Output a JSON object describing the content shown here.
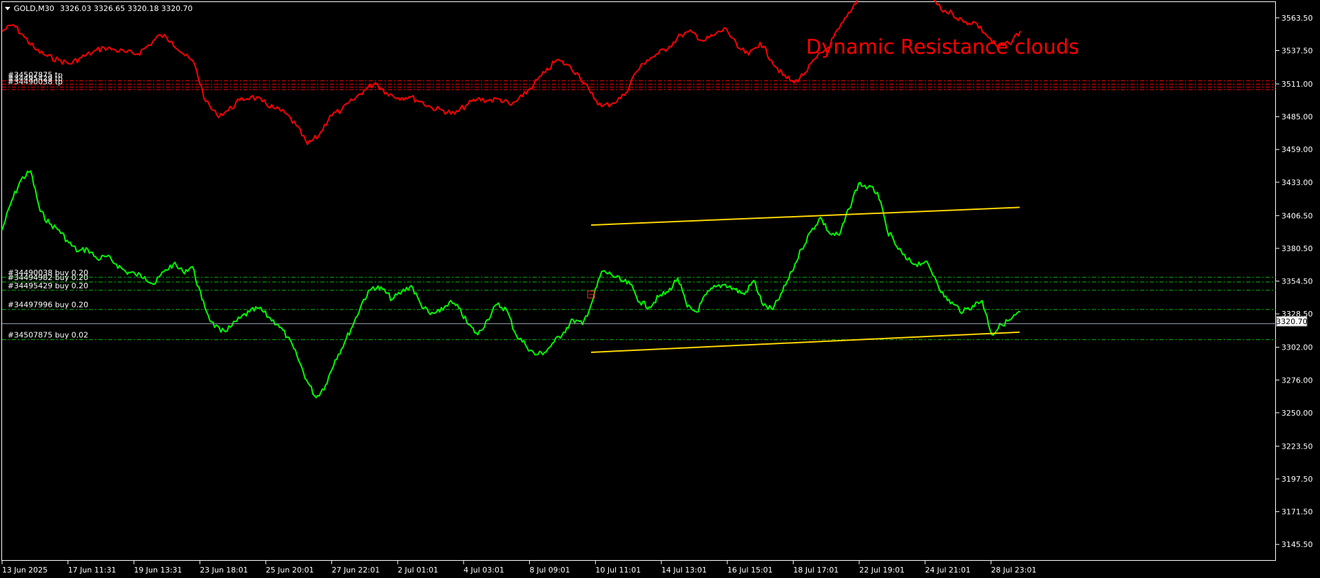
{
  "window": {
    "symbol_tf": "GOLD,M30",
    "ohlc": "3326.03 3326.65 3320.18 3320.70"
  },
  "annotation": {
    "text": "Dynamic Resistance clouds",
    "color": "#ff0000"
  },
  "current_price": {
    "label": "3320.70",
    "value": 3320.7
  },
  "orders": {
    "tp_labels": [
      "#34507875 tp",
      "#34495429 tp",
      "#34490038 tp"
    ],
    "buy": [
      {
        "label": "#34490038 buy 0.20",
        "price": 3357.5
      },
      {
        "label": "#34494982 buy 0.20",
        "price": 3353.8
      },
      {
        "label": "#34495429 buy 0.20",
        "price": 3347.2
      },
      {
        "label": "#34497996 buy 0.20",
        "price": 3332.0
      },
      {
        "label": "#34507875 buy 0.02",
        "price": 3308.0
      }
    ],
    "tp_prices": [
      3513.5,
      3510.8,
      3508.5,
      3506.5
    ]
  },
  "colors": {
    "price_line": "#00ff00",
    "resistance_line": "#ff0000",
    "trendline": "#ffd700",
    "buy_level": "#00c000",
    "tp_level": "#ff0000",
    "bid_line": "#9aa4b4",
    "axis": "#ffffff"
  },
  "chart_data": {
    "type": "line",
    "title": "GOLD,M30",
    "ylim": [
      3132.5,
      3576.0
    ],
    "grid": false,
    "y_ticks": [
      3563.5,
      3537.5,
      3511.0,
      3485.0,
      3459.0,
      3433.0,
      3406.5,
      3380.5,
      3354.5,
      3328.5,
      3302.0,
      3276.0,
      3250.0,
      3223.5,
      3197.5,
      3171.5,
      3145.5
    ],
    "x_ticks": [
      "13 Jun 2025",
      "17 Jun 11:31",
      "19 Jun 13:31",
      "23 Jun 18:01",
      "25 Jun 20:01",
      "27 Jun 22:01",
      "2 Jul 01:01",
      "4 Jul 03:01",
      "8 Jul 09:01",
      "10 Jul 11:01",
      "14 Jul 13:01",
      "16 Jul 15:01",
      "18 Jul 17:01",
      "22 Jul 19:01",
      "24 Jul 21:01",
      "28 Jul 23:01"
    ],
    "series": [
      {
        "type": "line",
        "values": [
          3395,
          3418,
          3435,
          3442,
          3410,
          3400,
          3395,
          3385,
          3378,
          3380,
          3372,
          3374,
          3368,
          3362,
          3360,
          3358,
          3352,
          3362,
          3368,
          3362,
          3366,
          3340,
          3322,
          3314,
          3318,
          3325,
          3330,
          3333,
          3326,
          3320,
          3310,
          3295,
          3276,
          3262,
          3272,
          3292,
          3306,
          3322,
          3340,
          3350,
          3348,
          3340,
          3346,
          3351,
          3336,
          3328,
          3330,
          3338,
          3333,
          3320,
          3312,
          3324,
          3336,
          3332,
          3312,
          3304,
          3296,
          3298,
          3306,
          3314,
          3324,
          3320,
          3338,
          3362,
          3360,
          3355,
          3352,
          3338,
          3334,
          3342,
          3346,
          3357,
          3334,
          3330,
          3344,
          3350,
          3352,
          3348,
          3344,
          3355,
          3335,
          3332,
          3346,
          3362,
          3380,
          3394,
          3405,
          3392,
          3391,
          3412,
          3432,
          3429,
          3425,
          3395,
          3382,
          3372,
          3368,
          3370,
          3358,
          3342,
          3336,
          3330,
          3335,
          3339,
          3312,
          3320,
          3324,
          3330
        ]
      },
      {
        "type": "line",
        "values": [
          3553,
          3558,
          3548,
          3538,
          3533,
          3530,
          3527,
          3532,
          3536,
          3540,
          3538,
          3536,
          3535,
          3542,
          3550,
          3545,
          3535,
          3527,
          3497,
          3486,
          3490,
          3498,
          3501,
          3497,
          3492,
          3488,
          3478,
          3463,
          3470,
          3486,
          3490,
          3498,
          3506,
          3512,
          3504,
          3500,
          3501,
          3497,
          3492,
          3490,
          3487,
          3494,
          3499,
          3498,
          3499,
          3494,
          3501,
          3511,
          3520,
          3530,
          3526,
          3518,
          3504,
          3493,
          3496,
          3502,
          3520,
          3530,
          3535,
          3541,
          3550,
          3552,
          3545,
          3550,
          3555,
          3540,
          3534,
          3544,
          3530,
          3518,
          3512,
          3520,
          3532,
          3540,
          3555,
          3568,
          3585,
          3600,
          3612,
          3608,
          3595,
          3592,
          3582,
          3570,
          3567,
          3560,
          3560,
          3550,
          3540,
          3543,
          3553
        ]
      },
      {
        "type": "line",
        "name": "upper trendline",
        "x": [
          "2025-07-09",
          "2025-07-28"
        ],
        "values": [
          3399.0,
          3413.0
        ]
      },
      {
        "type": "line",
        "name": "lower trendline",
        "x": [
          "2025-07-09",
          "2025-07-28"
        ],
        "values": [
          3298.0,
          3314.0
        ]
      }
    ]
  }
}
